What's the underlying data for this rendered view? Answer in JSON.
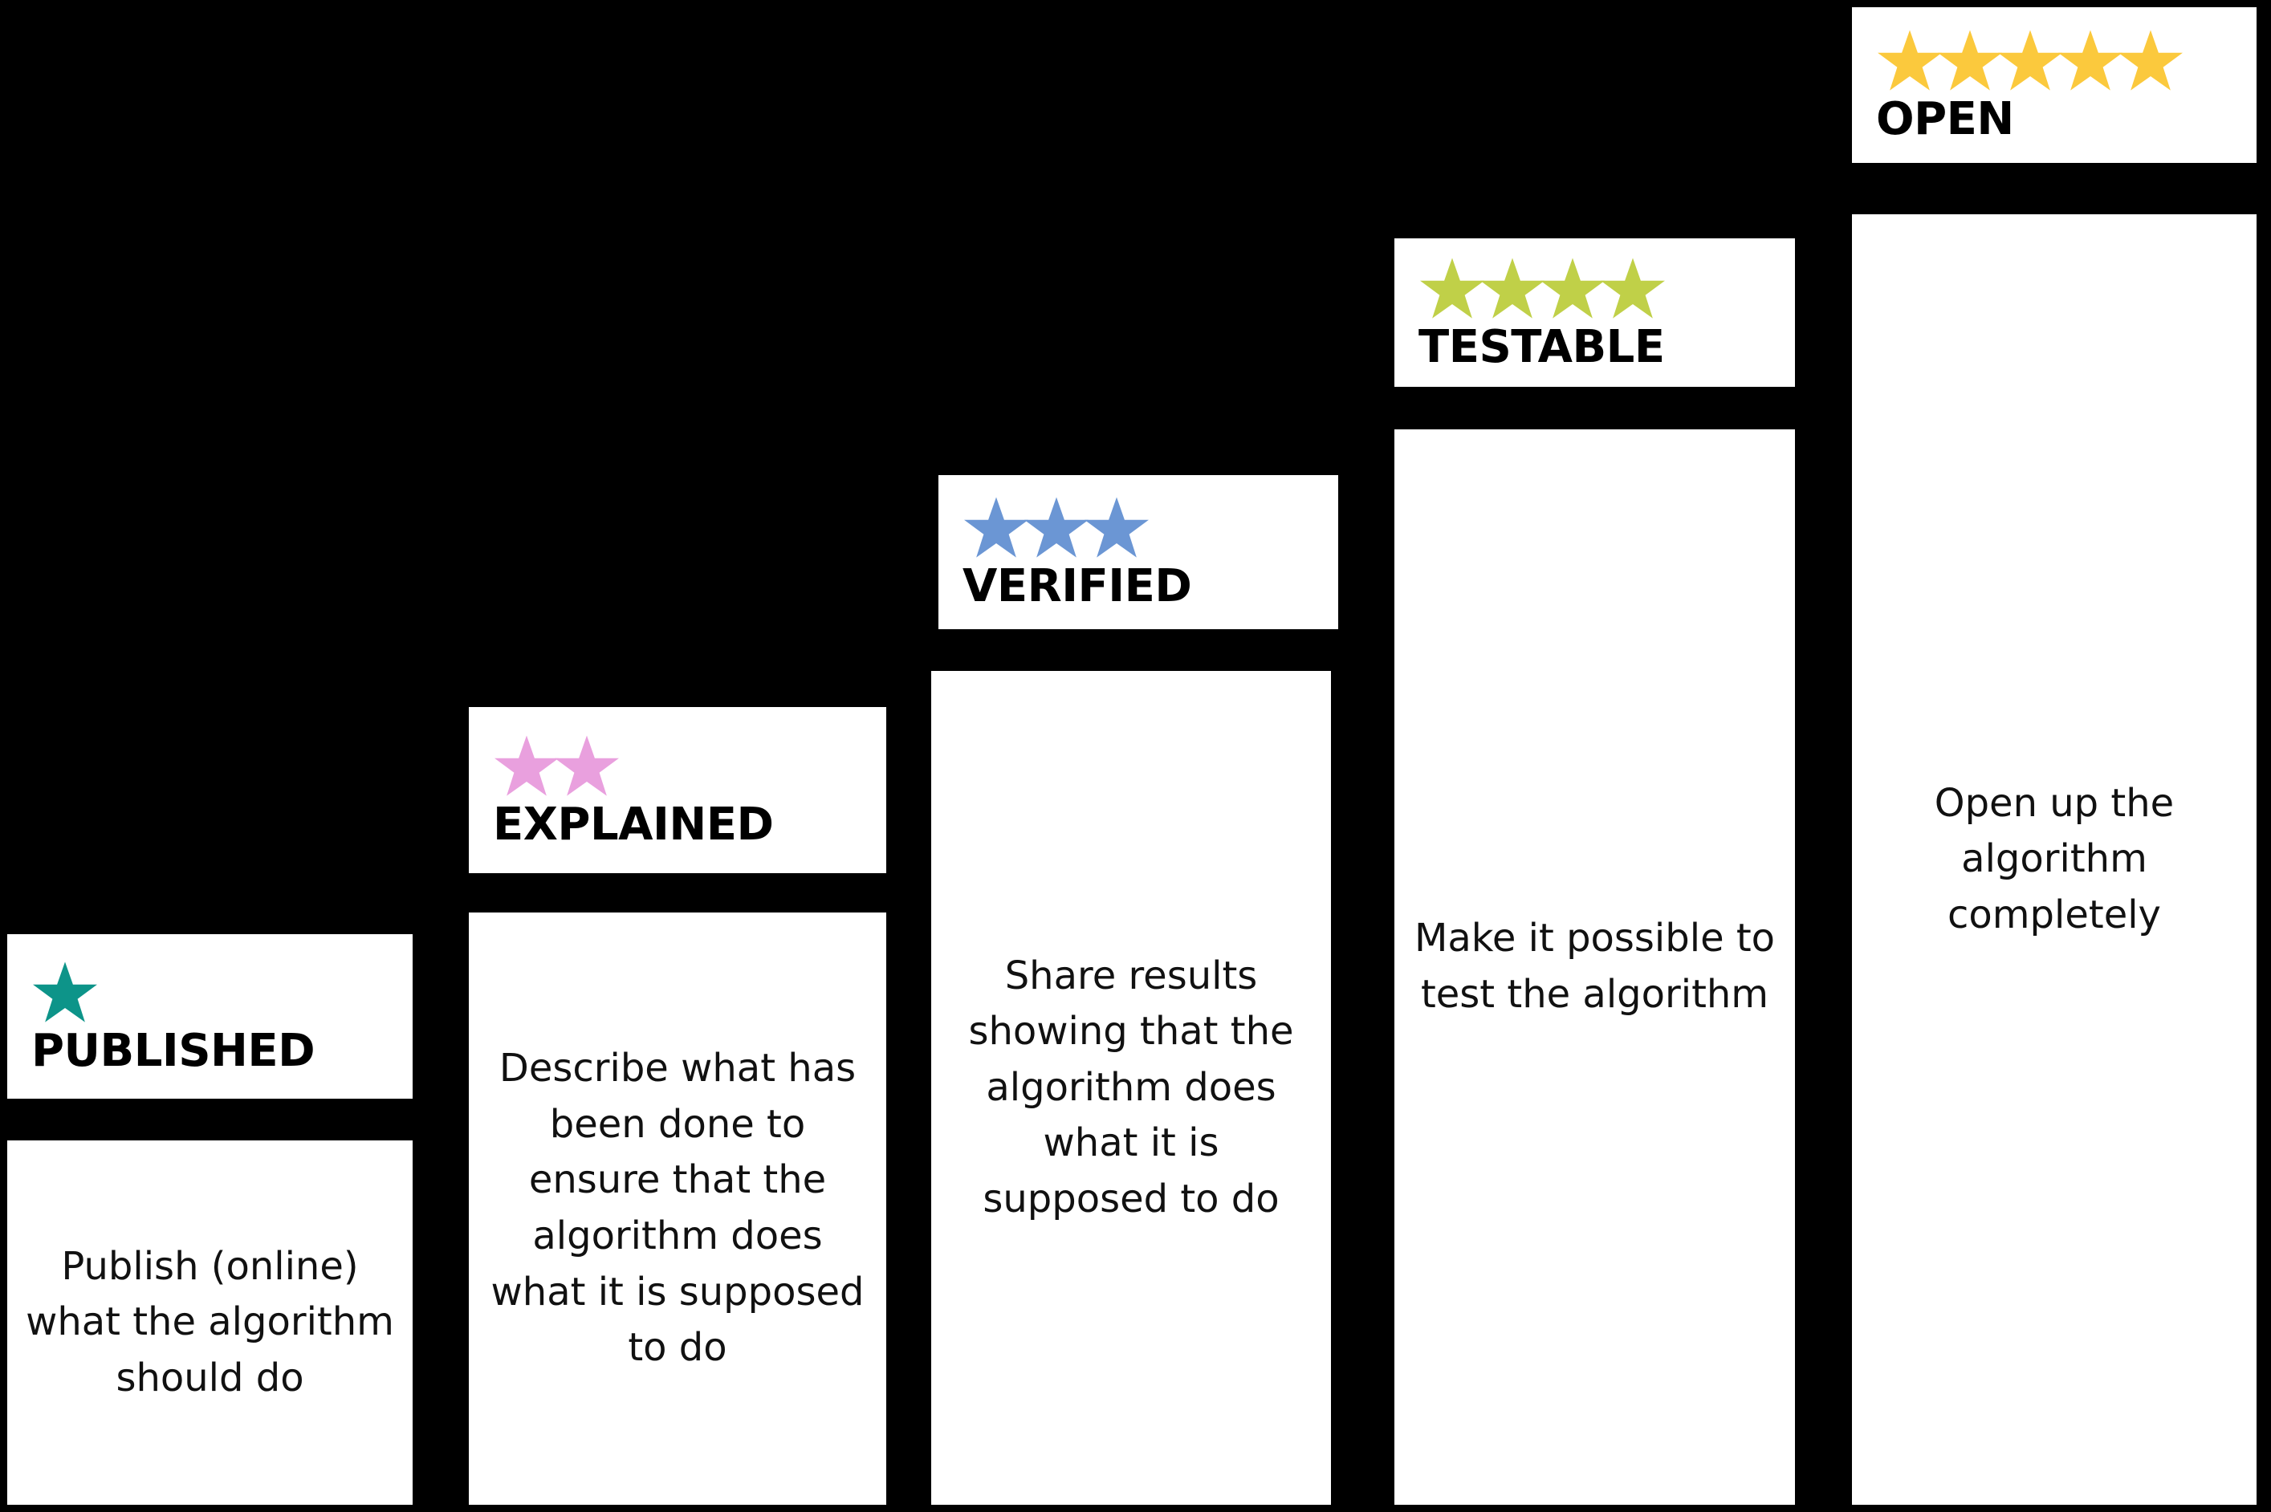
{
  "background_color": "#000000",
  "card_background": "#ffffff",
  "border_color": "#000000",
  "text_color": "#111111",
  "levels": [
    {
      "id": "published",
      "label": "PUBLISHED",
      "star_count": 1,
      "star_color": "#0d9489",
      "description": "Publish (online) what the algorithm should do"
    },
    {
      "id": "explained",
      "label": "EXPLAINED",
      "star_count": 2,
      "star_color": "#e9a0de",
      "description": "Describe what has been done to ensure that the algorithm does what it is supposed to do"
    },
    {
      "id": "verified",
      "label": "VERIFIED",
      "star_count": 3,
      "star_color": "#6b96d4",
      "description": "Share results showing that the algorithm does what it is supposed to do"
    },
    {
      "id": "testable",
      "label": "TESTABLE",
      "star_count": 4,
      "star_color": "#c0d048",
      "description": "Make it possible to test the algorithm"
    },
    {
      "id": "open",
      "label": "OPEN",
      "star_count": 5,
      "star_color": "#fbc93d",
      "description": "Open up the algorithm completely"
    }
  ]
}
